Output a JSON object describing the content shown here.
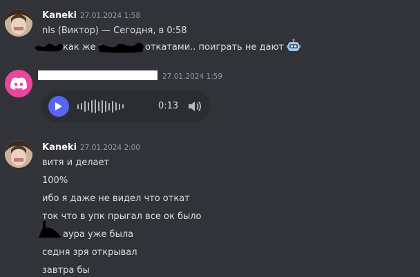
{
  "messages": [
    {
      "author": "Kaneki",
      "timestamp": "27.01.2024 1:58",
      "lines": [
        "nls (Виктор) — Сегодня, в 0:58",
        "как же з",
        "откатами.. поиграть не дают"
      ],
      "emoji": "robot-emoji"
    },
    {
      "author": "",
      "timestamp": "27.01.2024 1:59",
      "voice_message": {
        "duration": "0:13",
        "waveform": [
          0.35,
          0.5,
          0.8,
          0.6,
          0.9,
          1.0,
          0.7,
          0.95,
          0.8,
          0.55,
          0.85,
          0.6,
          0.45,
          0.3
        ]
      }
    },
    {
      "author": "Kaneki",
      "timestamp": "27.01.2024 2:00",
      "lines": [
        "витя и делает",
        "100%",
        "ибо я даже не видел что откат",
        "ток что в упк прыгал все ок было",
        "аура уже была",
        "седня зря открывал",
        "завтра бы"
      ]
    }
  ],
  "colors": {
    "background": "#313338",
    "discord_pink": "#eb459f",
    "blurple": "#5865f2",
    "voice_bg": "#2b2d31"
  }
}
